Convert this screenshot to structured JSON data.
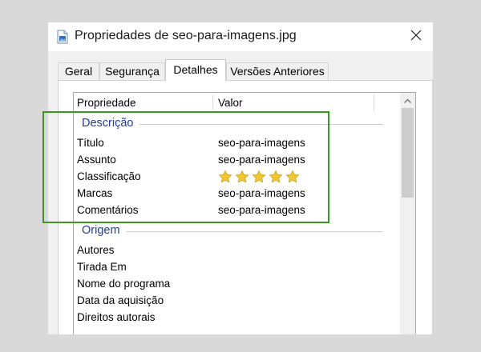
{
  "window": {
    "title": "Propriedades de seo-para-imagens.jpg"
  },
  "tabs": [
    {
      "label": "Geral"
    },
    {
      "label": "Segurança"
    },
    {
      "label": "Detalhes"
    },
    {
      "label": "Versões Anteriores"
    }
  ],
  "active_tab": "Detalhes",
  "columns": {
    "property": "Propriedade",
    "value": "Valor"
  },
  "groups": {
    "descricao": {
      "label": "Descrição",
      "rows": [
        {
          "property": "Título",
          "value": "seo-para-imagens"
        },
        {
          "property": "Assunto",
          "value": "seo-para-imagens"
        },
        {
          "property": "Classificação",
          "rating": 5,
          "rating_max": 5
        },
        {
          "property": "Marcas",
          "value": "seo-para-imagens"
        },
        {
          "property": "Comentários",
          "value": "seo-para-imagens"
        }
      ]
    },
    "origem": {
      "label": "Origem",
      "rows": [
        {
          "property": "Autores",
          "value": ""
        },
        {
          "property": "Tirada Em",
          "value": ""
        },
        {
          "property": "Nome do programa",
          "value": ""
        },
        {
          "property": "Data da aquisição",
          "value": ""
        },
        {
          "property": "Direitos autorais",
          "value": ""
        }
      ]
    }
  },
  "colors": {
    "group_header": "#1e3f9a",
    "highlight_box": "#3a9a1f",
    "star": "#f2c62f"
  },
  "icons": {
    "file": "image-file-icon",
    "close": "close-icon",
    "scroll_up": "chevron-up-icon",
    "star": "star-icon"
  }
}
